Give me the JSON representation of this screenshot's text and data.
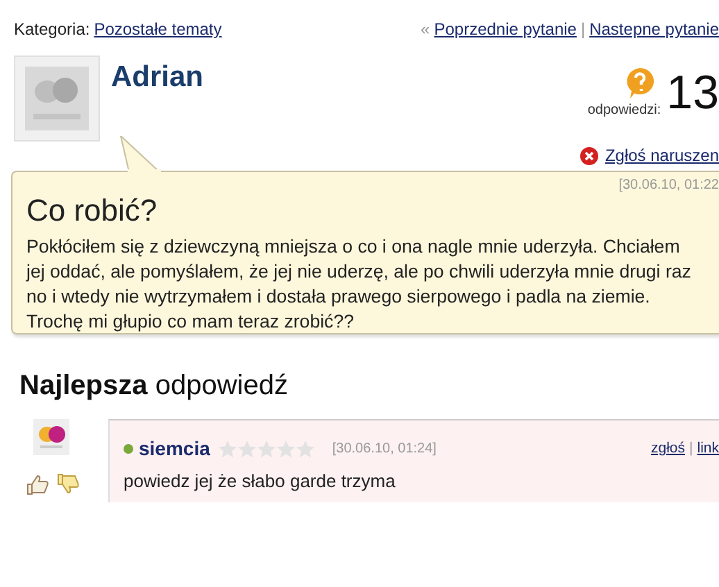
{
  "category": {
    "label": "Kategoria:",
    "link": "Pozostałe tematy"
  },
  "nav": {
    "prev_mark": "«",
    "prev": "Poprzednie pytanie",
    "separator": "|",
    "next": "Nastepne pytanie"
  },
  "question": {
    "author": "Adrian",
    "answers_label": "odpowiedzi:",
    "answers_count": "13",
    "report": "Zgłoś naruszen",
    "date": "[30.06.10, 01:22",
    "title": "Co robić?",
    "body": "Pokłóciłem się z dziewczyną mniejsza o co i ona nagle mnie uderzyła. Chciałem jej oddać, ale pomyślałem, że jej nie uderzę, ale po chwili uderzyła mnie drugi raz no i wtedy nie wytrzymałem i dostała prawego sierpowego i padla na ziemie. Trochę mi głupio co mam teraz zrobić??"
  },
  "best_answer": {
    "heading": "**Najlepsza** odpowiedź",
    "author": "siemcia",
    "online": true,
    "stars": 0,
    "date": "[30.06.10, 01:24]",
    "report": "zgłoś",
    "separator": "|",
    "link": "link",
    "text": "powiedz jej że słabo garde trzyma"
  }
}
